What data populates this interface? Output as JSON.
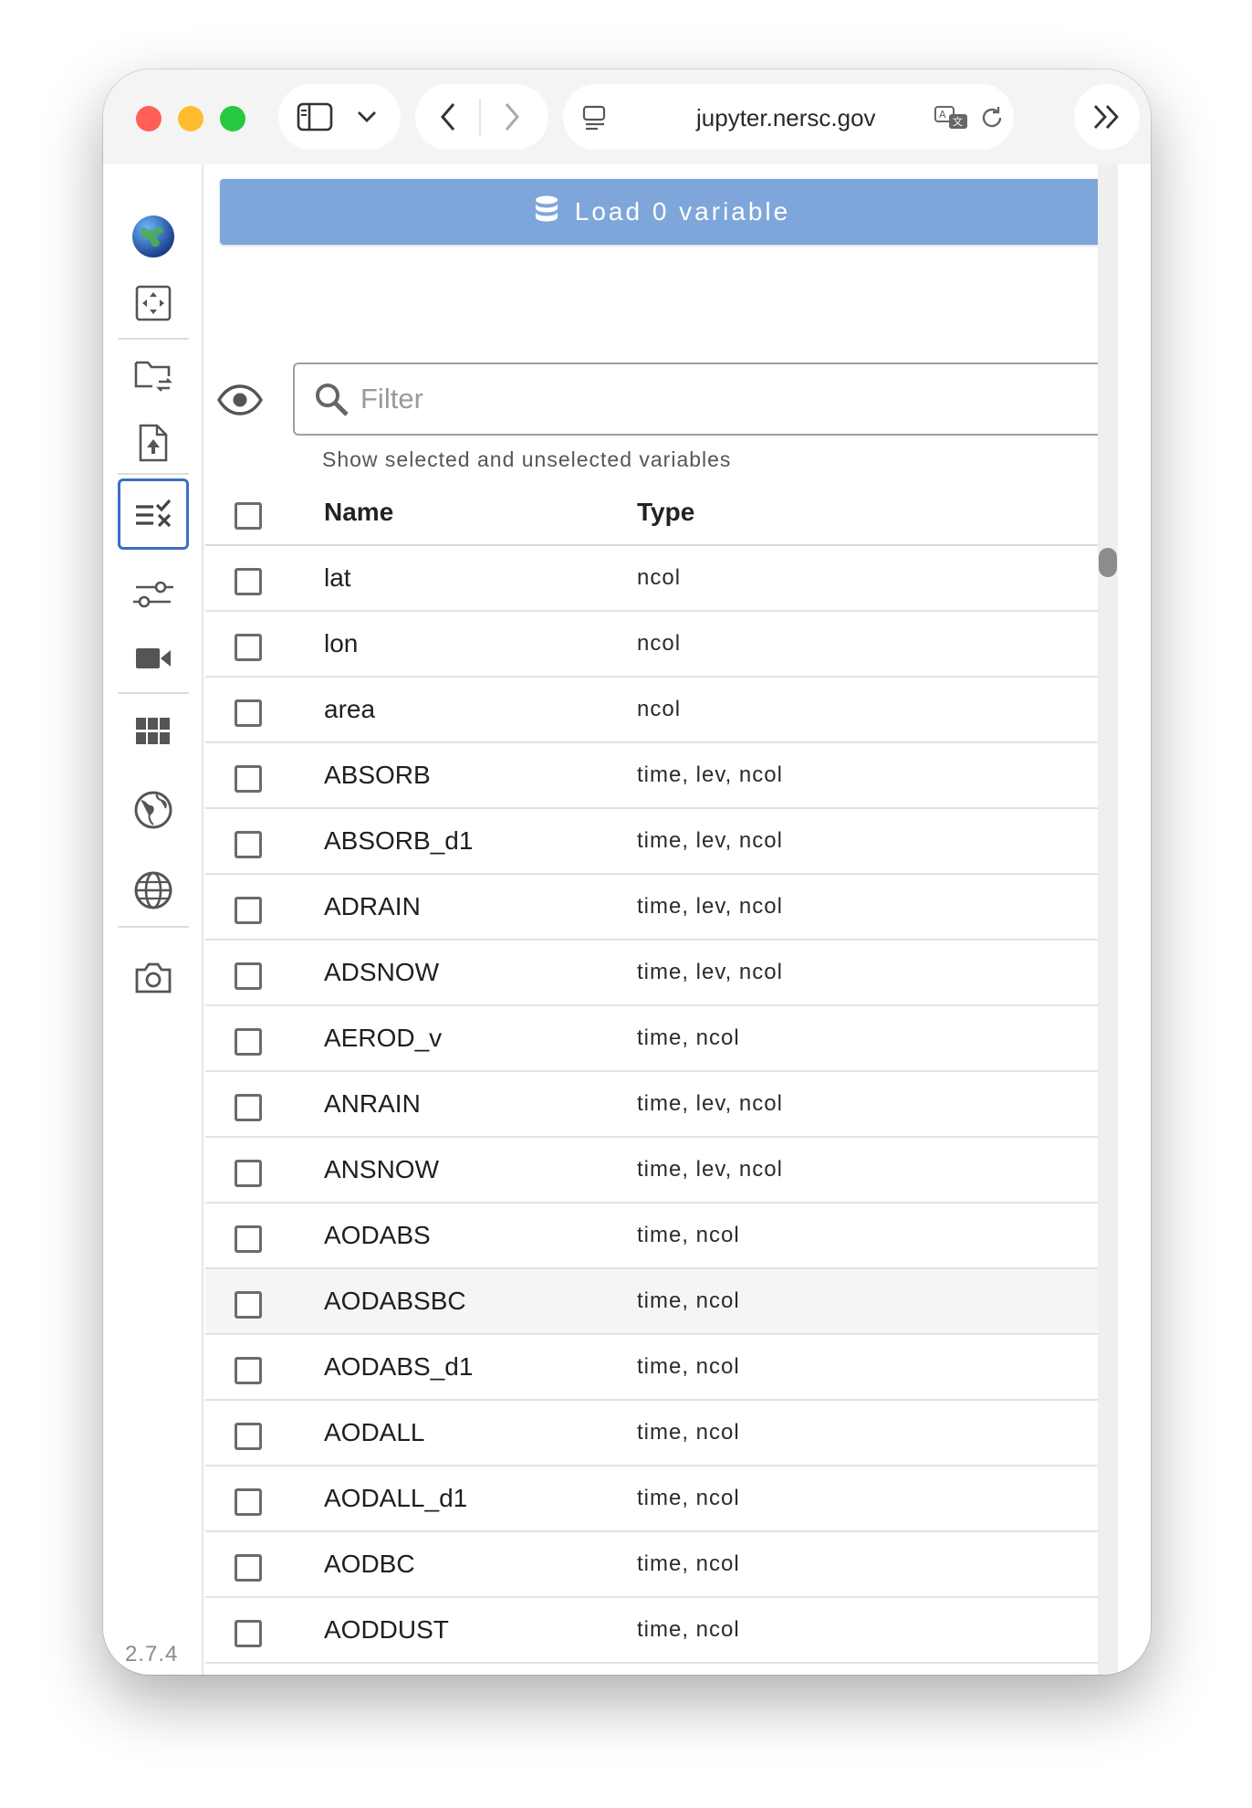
{
  "browser": {
    "url": "jupyter.nersc.gov"
  },
  "panel": {
    "load_button_label": "Load 0 variable",
    "filter_placeholder": "Filter",
    "filter_help": "Show selected and unselected variables",
    "version": "2.7.4"
  },
  "table": {
    "columns": {
      "name": "Name",
      "type": "Type"
    },
    "rows": [
      {
        "name": "lat",
        "type": "ncol"
      },
      {
        "name": "lon",
        "type": "ncol"
      },
      {
        "name": "area",
        "type": "ncol"
      },
      {
        "name": "ABSORB",
        "type": "time, lev, ncol"
      },
      {
        "name": "ABSORB_d1",
        "type": "time, lev, ncol"
      },
      {
        "name": "ADRAIN",
        "type": "time, lev, ncol"
      },
      {
        "name": "ADSNOW",
        "type": "time, lev, ncol"
      },
      {
        "name": "AEROD_v",
        "type": "time, ncol"
      },
      {
        "name": "ANRAIN",
        "type": "time, lev, ncol"
      },
      {
        "name": "ANSNOW",
        "type": "time, lev, ncol"
      },
      {
        "name": "AODABS",
        "type": "time, ncol"
      },
      {
        "name": "AODABSBC",
        "type": "time, ncol"
      },
      {
        "name": "AODABS_d1",
        "type": "time, ncol"
      },
      {
        "name": "AODALL",
        "type": "time, ncol"
      },
      {
        "name": "AODALL_d1",
        "type": "time, ncol"
      },
      {
        "name": "AODBC",
        "type": "time, ncol"
      },
      {
        "name": "AODDUST",
        "type": "time, ncol"
      }
    ]
  },
  "icons": {
    "activity_bar": [
      "globe-logo-icon",
      "arrows-move-icon",
      "folder-sync-icon",
      "file-upload-icon",
      "variable-select-icon",
      "sliders-icon",
      "video-camera-icon",
      "grid-icon",
      "globe-outline-icon",
      "globe-grid-icon",
      "camera-icon"
    ],
    "load_button": "database-icon",
    "filter": "search-icon",
    "visibility": "eye-icon"
  },
  "colors": {
    "load_button": "#7fa6da",
    "active_outline": "#3a6fc2"
  }
}
